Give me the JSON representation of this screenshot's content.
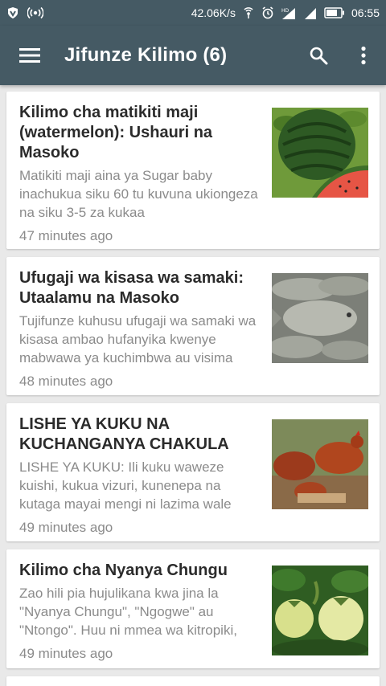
{
  "status_bar": {
    "network_speed": "42.06K/s",
    "time": "06:55",
    "icons": [
      "vpn-shield-icon",
      "broadcast-icon",
      "hotspot-icon",
      "alarm-icon",
      "signal-hd-icon",
      "signal-icon",
      "battery-icon"
    ]
  },
  "app_bar": {
    "title": "Jifunze Kilimo (6)",
    "icons": [
      "menu-icon",
      "search-icon",
      "more-vertical-icon"
    ]
  },
  "articles": [
    {
      "title": "Kilimo cha matikiti maji (watermelon): Ushauri na Masoko",
      "excerpt": "Matikiti maji aina ya  Sugar baby inachukua siku 60 tu kuvuna ukiongeza na  siku 3-5 za kukaa",
      "time": "47 minutes ago",
      "image": "watermelon-image"
    },
    {
      "title": "Ufugaji wa kisasa wa samaki: Utaalamu na Masoko",
      "excerpt": "Tujifunze kuhusu ufugaji wa samaki wa kisasa ambao hufanyika kwenye mabwawa ya kuchimbwa au visima",
      "time": "48 minutes ago",
      "image": "fish-image"
    },
    {
      "title": "LISHE YA KUKU NA KUCHANGANYA CHAKULA",
      "excerpt": "LISHE YA KUKU: Ili kuku waweze kuishi, kukua vizuri, kunenepa na kutaga mayai mengi ni lazima wale",
      "time": "49 minutes ago",
      "image": "chickens-image"
    },
    {
      "title": "Kilimo cha Nyanya Chungu",
      "excerpt": " Zao hili pia hujulikana kwa jina la \"Nyanya Chungu\", \"Ngogwe\" au \"Ntongo\". Huu ni mmea wa kitropiki,",
      "time": "49 minutes ago",
      "image": "garden-eggs-image"
    }
  ],
  "colors": {
    "app_bar": "#455a64",
    "background": "#e9e9e9",
    "card": "#ffffff",
    "title_text": "#2b2b2b",
    "secondary_text": "#8b8b8b"
  }
}
